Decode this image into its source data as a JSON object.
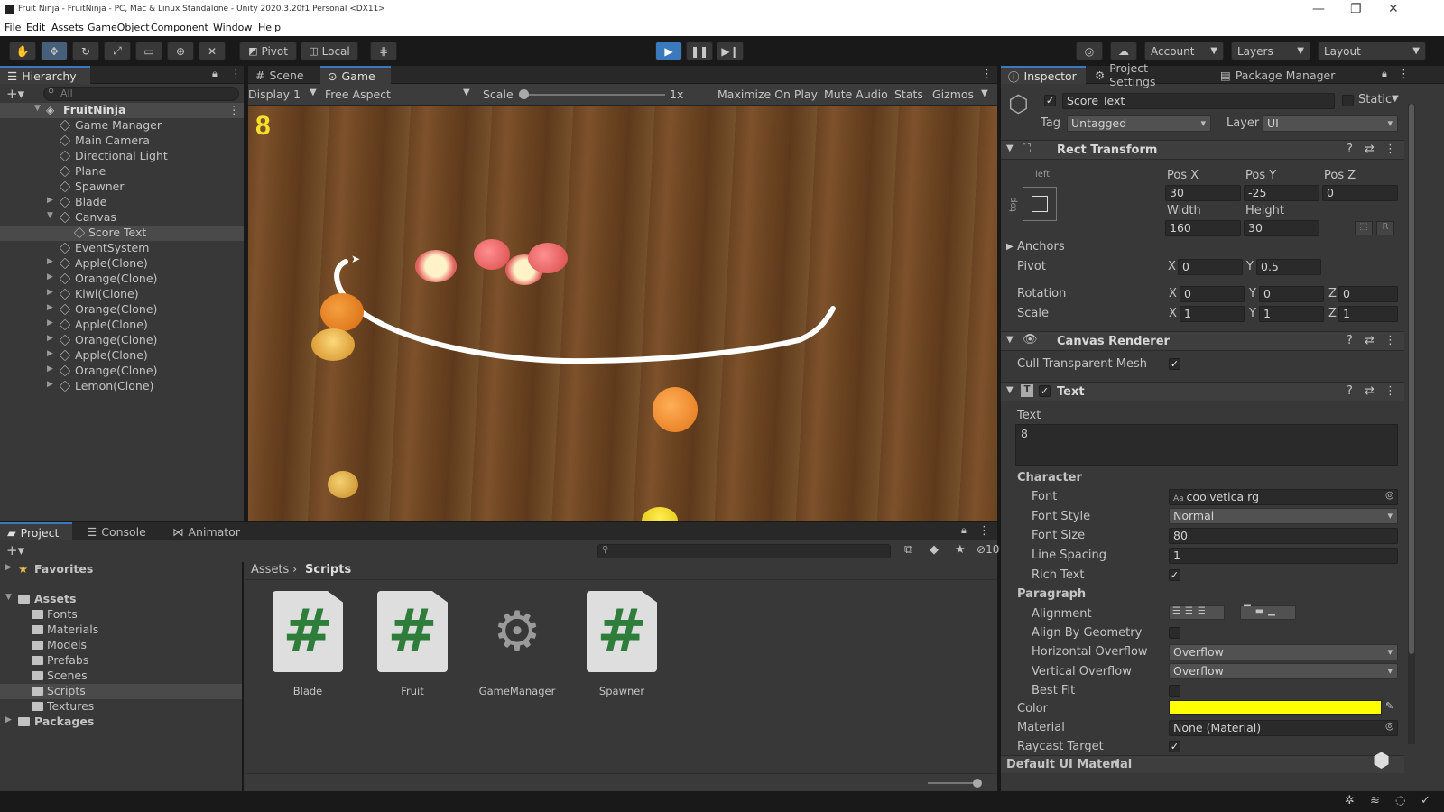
{
  "window": {
    "title": "Fruit Ninja - FruitNinja - PC, Mac & Linux Standalone - Unity 2020.3.20f1 Personal <DX11>",
    "minimize": "—",
    "maximize": "❐",
    "close": "✕"
  },
  "menu": [
    "File",
    "Edit",
    "Assets",
    "GameObject",
    "Component",
    "Window",
    "Help"
  ],
  "toolbar": {
    "pivot": "Pivot",
    "local": "Local",
    "account": "Account",
    "layers": "Layers",
    "layout": "Layout"
  },
  "hierarchy": {
    "tab": "Hierarchy",
    "search_placeholder": "All",
    "scene": "FruitNinja",
    "items": [
      "Game Manager",
      "Main Camera",
      "Directional Light",
      "Plane",
      "Spawner",
      "Blade",
      "Canvas",
      "Score Text",
      "EventSystem",
      "Apple(Clone)",
      "Orange(Clone)",
      "Kiwi(Clone)",
      "Orange(Clone)",
      "Apple(Clone)",
      "Orange(Clone)",
      "Apple(Clone)",
      "Orange(Clone)",
      "Lemon(Clone)"
    ]
  },
  "game_view": {
    "tabs": [
      "Scene",
      "Game"
    ],
    "display": "Display 1",
    "aspect": "Free Aspect",
    "scale_label": "Scale",
    "scale_value": "1x",
    "maximize": "Maximize On Play",
    "mute": "Mute Audio",
    "stats": "Stats",
    "gizmos": "Gizmos",
    "score": "8",
    "score_color": "#f5e02a"
  },
  "inspector": {
    "tabs": [
      "Inspector",
      "Project Settings",
      "Package Manager"
    ],
    "object_name": "Score Text",
    "static_label": "Static",
    "tag_label": "Tag",
    "tag_value": "Untagged",
    "layer_label": "Layer",
    "layer_value": "UI",
    "rect_transform": {
      "title": "Rect Transform",
      "anchor_h": "left",
      "anchor_v": "top",
      "posx_label": "Pos X",
      "posx": "30",
      "posy_label": "Pos Y",
      "posy": "-25",
      "posz_label": "Pos Z",
      "posz": "0",
      "width_label": "Width",
      "width": "160",
      "height_label": "Height",
      "height": "30",
      "r_button": "R",
      "anchors": "Anchors",
      "pivot": "Pivot",
      "pivot_x": "0",
      "pivot_y": "0.5",
      "rotation": "Rotation",
      "rot_x": "0",
      "rot_y": "0",
      "rot_z": "0",
      "scale": "Scale",
      "scale_x": "1",
      "scale_y": "1",
      "scale_z": "1",
      "x": "X",
      "y": "Y",
      "z": "Z"
    },
    "canvas_renderer": {
      "title": "Canvas Renderer",
      "cull": "Cull Transparent Mesh"
    },
    "text": {
      "title": "Text",
      "text_label": "Text",
      "text_value": "8",
      "character": "Character",
      "font_label": "Font",
      "font_value": "coolvetica rg",
      "font_style_label": "Font Style",
      "font_style_value": "Normal",
      "font_size_label": "Font Size",
      "font_size_value": "80",
      "line_spacing_label": "Line Spacing",
      "line_spacing_value": "1",
      "rich_text": "Rich Text",
      "paragraph": "Paragraph",
      "alignment": "Alignment",
      "align_geometry": "Align By Geometry",
      "h_overflow_label": "Horizontal Overflow",
      "h_overflow_value": "Overflow",
      "v_overflow_label": "Vertical Overflow",
      "v_overflow_value": "Overflow",
      "best_fit": "Best Fit",
      "color_label": "Color",
      "color_value": "#ffff00",
      "material_label": "Material",
      "material_value": "None (Material)",
      "raycast": "Raycast Target"
    },
    "footer_material": "Default UI Material"
  },
  "project": {
    "tabs": [
      "Project",
      "Console",
      "Animator"
    ],
    "favorites": "Favorites",
    "assets": "Assets",
    "folders": [
      "Fonts",
      "Materials",
      "Models",
      "Prefabs",
      "Scenes",
      "Scripts",
      "Textures"
    ],
    "packages": "Packages",
    "breadcrumb": [
      "Assets",
      "Scripts"
    ],
    "hidden_count": "10",
    "files": [
      {
        "name": "Blade",
        "kind": "script"
      },
      {
        "name": "Fruit",
        "kind": "script"
      },
      {
        "name": "GameManager",
        "kind": "gear"
      },
      {
        "name": "Spawner",
        "kind": "script"
      }
    ]
  }
}
